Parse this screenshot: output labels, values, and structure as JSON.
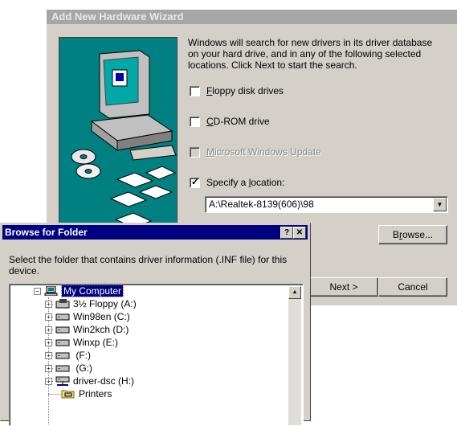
{
  "wizard": {
    "title": "Add New Hardware Wizard",
    "description": "Windows will search for new drivers in its driver database on your hard drive, and in any of the following selected locations. Click Next to start the search.",
    "options": [
      {
        "label_pre": "",
        "label_u": "F",
        "label_post": "loppy disk drives",
        "checked": false,
        "enabled": true
      },
      {
        "label_pre": "",
        "label_u": "C",
        "label_post": "D-ROM drive",
        "checked": false,
        "enabled": true
      },
      {
        "label_pre": "",
        "label_u": "M",
        "label_post": "icrosoft Windows Update",
        "checked": false,
        "enabled": false
      },
      {
        "label_pre": "Specify a ",
        "label_u": "l",
        "label_post": "ocation:",
        "checked": true,
        "enabled": true
      }
    ],
    "location_value": "A:\\Realtek-8139(606)\\98",
    "browse_label_u": "r",
    "browse_label_pre": "B",
    "browse_label_post": "owse...",
    "next_label": "Next >",
    "cancel_label": "Cancel"
  },
  "browse_dialog": {
    "title": "Browse for Folder",
    "help_glyph": "?",
    "close_glyph": "✕",
    "instruction": "Select the folder that contains driver information (.INF file) for this device.",
    "tree": [
      {
        "label": "My Computer",
        "icon": "computer-icon",
        "expander": "−",
        "selected": true
      },
      {
        "label": "3½ Floppy (A:)",
        "icon": "floppy-drive-icon",
        "expander": "+"
      },
      {
        "label": "Win98en (C:)",
        "icon": "hard-drive-icon",
        "expander": "+"
      },
      {
        "label": "Win2kch (D:)",
        "icon": "hard-drive-icon",
        "expander": "+"
      },
      {
        "label": "Winxp (E:)",
        "icon": "hard-drive-icon",
        "expander": "+"
      },
      {
        "label": " (F:)",
        "icon": "hard-drive-icon",
        "expander": "+"
      },
      {
        "label": " (G:)",
        "icon": "hard-drive-icon",
        "expander": "+"
      },
      {
        "label": "driver-dsc (H:)",
        "icon": "network-drive-icon",
        "expander": "+"
      },
      {
        "label": "Printers",
        "icon": "printers-folder-icon",
        "expander": ""
      }
    ]
  }
}
